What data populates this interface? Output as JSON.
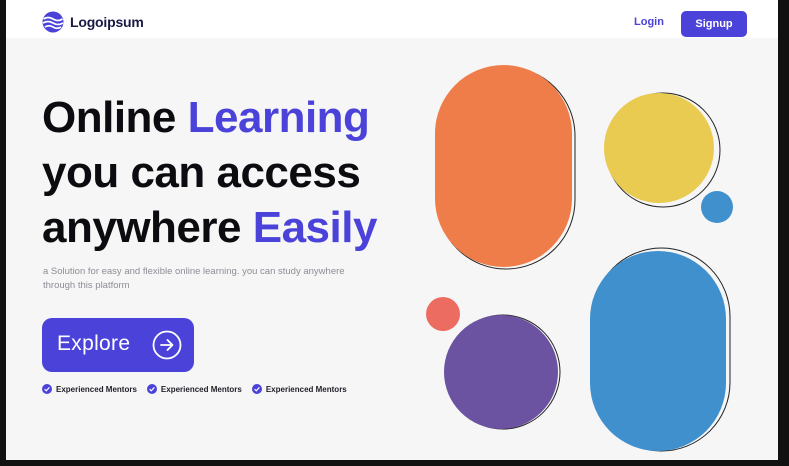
{
  "nav": {
    "logo_text": "Logoipsum",
    "login_label": "Login",
    "signup_label": "Signup"
  },
  "hero": {
    "title_line1_a": "Online ",
    "title_line1_b": "Learning",
    "title_line2": "you can access",
    "title_line3_a": "anywhere ",
    "title_line3_b": "Easily",
    "subtitle": "a Solution for easy and flexible online learning. you can study anywhere through this platform",
    "explore_label": "Explore"
  },
  "features": [
    {
      "label": "Experienced Mentors"
    },
    {
      "label": "Experienced Mentors"
    },
    {
      "label": "Experienced Mentors"
    }
  ],
  "colors": {
    "accent": "#4b43d9",
    "orange": "#ef7d4a",
    "yellow": "#eacb52",
    "blue": "#4190ce",
    "purple": "#6c53a1",
    "red": "#ed6c62"
  },
  "icons": {
    "logo": "logo-waves-icon",
    "explore": "arrow-right-circle-icon",
    "feature": "check-circle-icon"
  }
}
